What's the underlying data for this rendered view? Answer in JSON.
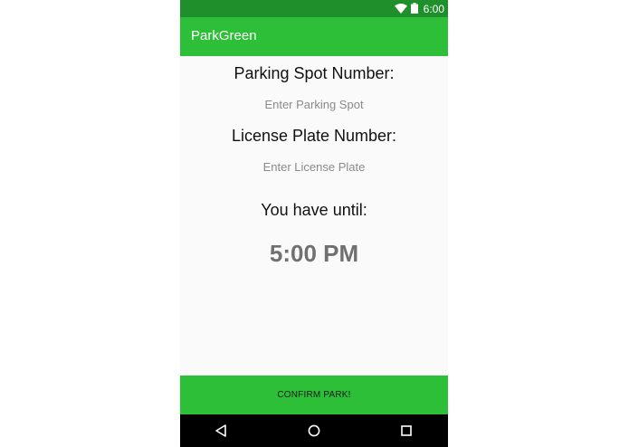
{
  "status_bar": {
    "time": "6:00",
    "icons": [
      "wifi-icon",
      "battery-icon"
    ]
  },
  "app_bar": {
    "title": "ParkGreen"
  },
  "form": {
    "spot_label": "Parking Spot Number:",
    "spot_placeholder": "Enter Parking Spot",
    "spot_value": "",
    "plate_label": "License Plate Number:",
    "plate_placeholder": "Enter License Plate",
    "plate_value": ""
  },
  "expiry": {
    "label": "You have until:",
    "time": "5:00 PM"
  },
  "actions": {
    "confirm_label": "CONFIRM PARK!"
  },
  "nav": {
    "icons": [
      "back-icon",
      "home-icon",
      "recents-icon"
    ]
  },
  "colors": {
    "status_bar": "#1f8f2b",
    "app_bar": "#2cbf37",
    "button": "#2cbf37",
    "background": "#fafafa",
    "nav_bar": "#000000"
  }
}
